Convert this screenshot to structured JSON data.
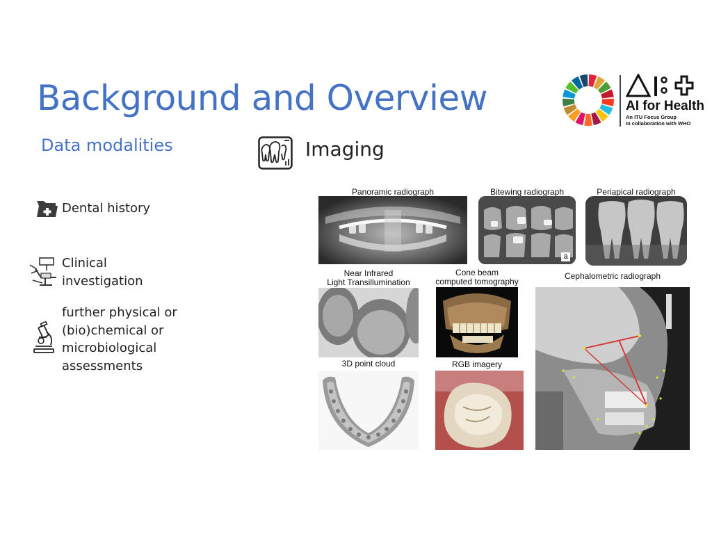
{
  "slide": {
    "title": "Background and Overview",
    "subtitle": "Data modalities",
    "imaging_label": "Imaging"
  },
  "modalities": [
    {
      "label": "Dental history",
      "icon": "medical-folder-icon"
    },
    {
      "label": "Clinical investigation",
      "icon": "dental-chair-icon"
    },
    {
      "label": "further physical or (bio)chemical or microbiological assessments",
      "icon": "microscope-icon"
    }
  ],
  "logo": {
    "name": "AI for Health",
    "line1": "An ITU Focus Group",
    "line2": "In collaboration with WHO"
  },
  "images": {
    "panoramic": "Panoramic radiograph",
    "bitewing": "Bitewing radiograph",
    "bitewing_mark": "a",
    "periapical": "Periapical radiograph",
    "nir_line1": "Near Infrared",
    "nir_line2": "Light Transillumination",
    "cbct_line1": "Cone beam",
    "cbct_line2": "computed tomography",
    "ceph": "Cephalometric radiograph",
    "pointcloud": "3D point cloud",
    "rgb": "RGB imagery"
  },
  "colors": {
    "title": "#4472C4",
    "text": "#222222"
  }
}
